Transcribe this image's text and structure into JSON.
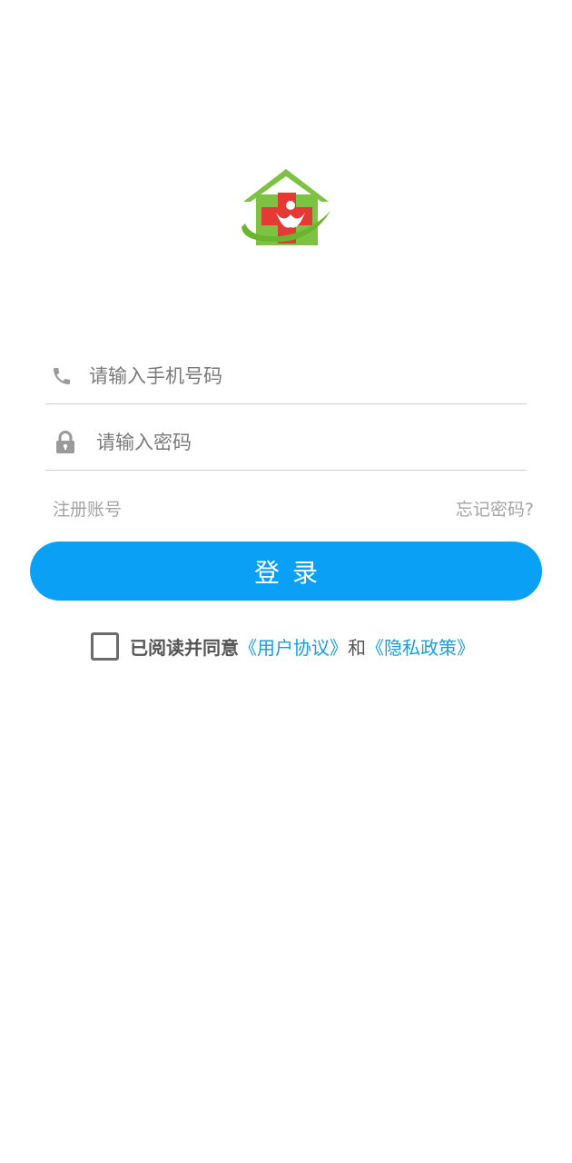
{
  "logo": {
    "icon": "medical-house-logo-icon"
  },
  "phone_field": {
    "icon": "phone-icon",
    "placeholder": "请输入手机号码",
    "value": ""
  },
  "password_field": {
    "icon": "lock-icon",
    "placeholder": "请输入密码",
    "value": ""
  },
  "links": {
    "register": "注册账号",
    "forgot_password": "忘记密码?"
  },
  "login_button": {
    "label": "登录"
  },
  "agreement": {
    "checked": false,
    "prefix": "已阅读并同意",
    "user_agreement": "《用户协议》",
    "and": "和",
    "privacy_policy": "《隐私政策》"
  },
  "colors": {
    "primary": "#0aa0f6",
    "link": "#1a9ce0",
    "logo_green": "#7dc242",
    "logo_red": "#e53935"
  }
}
